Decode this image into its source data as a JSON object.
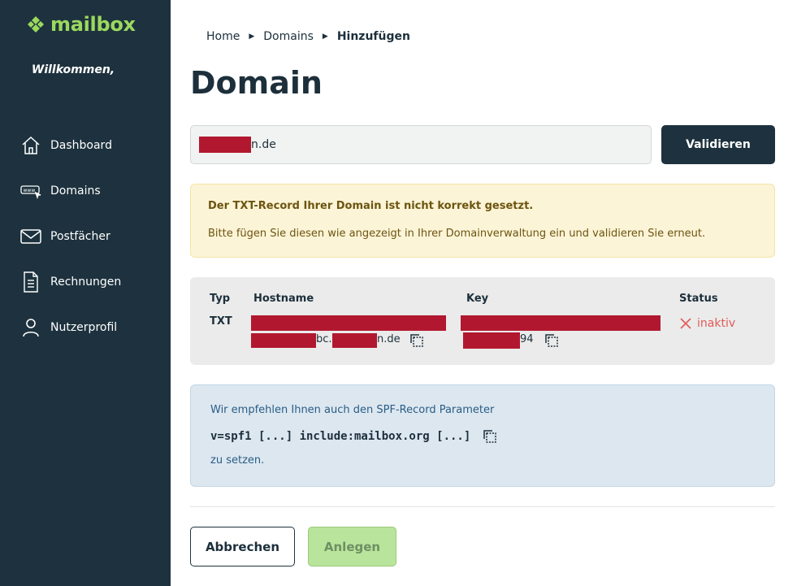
{
  "sidebar": {
    "logo_text": "mailbox",
    "welcome": "Willkommen,",
    "items": [
      {
        "label": "Dashboard",
        "icon": "home-icon"
      },
      {
        "label": "Domains",
        "icon": "www-icon"
      },
      {
        "label": "Postfächer",
        "icon": "mail-icon"
      },
      {
        "label": "Rechnungen",
        "icon": "document-icon"
      },
      {
        "label": "Nutzerprofil",
        "icon": "user-icon"
      }
    ]
  },
  "breadcrumb": [
    "Home",
    "Domains",
    "Hinzufügen"
  ],
  "page_title": "Domain",
  "domain_input": {
    "visible_suffix": "n.de"
  },
  "validate_button": "Validieren",
  "warning": {
    "title": "Der TXT-Record Ihrer Domain ist nicht korrekt gesetzt.",
    "message": "Bitte fügen Sie diesen wie angezeigt in Ihrer Domainverwaltung ein und validieren Sie erneut."
  },
  "dns_table": {
    "headers": {
      "type": "Typ",
      "hostname": "Hostname",
      "key": "Key",
      "status": "Status"
    },
    "row": {
      "type": "TXT",
      "hostname_fragments": [
        "bc.",
        "n.de"
      ],
      "key_fragment": "94",
      "status": "inaktiv"
    }
  },
  "spf": {
    "intro": "Wir empfehlen Ihnen auch den SPF-Record Parameter",
    "value": "v=spf1 [...] include:mailbox.org [...]",
    "outro": "zu setzen."
  },
  "buttons": {
    "cancel": "Abbrechen",
    "create": "Anlegen"
  },
  "colors": {
    "sidebar_bg": "#1d323e",
    "brand_green": "#9bd85e",
    "warning_bg": "#fcf4d7",
    "info_bg": "#dce7f0",
    "status_inactive": "#e05a57",
    "redaction": "#b1182f"
  }
}
